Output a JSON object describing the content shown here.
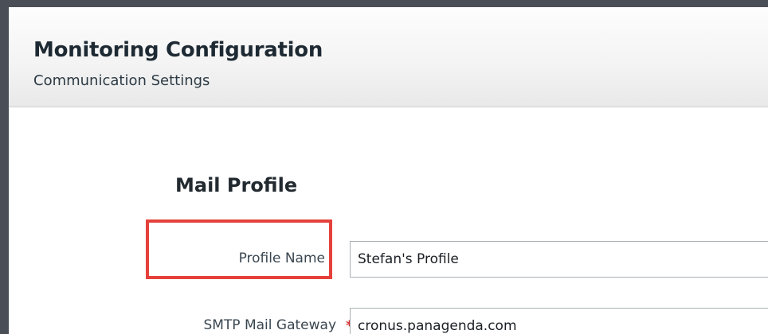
{
  "header": {
    "title": "Monitoring Configuration",
    "subtitle": "Communication Settings"
  },
  "section": {
    "title": "Mail Profile"
  },
  "form": {
    "profile_name": {
      "label": "Profile Name",
      "value": "Stefan's Profile"
    },
    "smtp_gateway": {
      "label": "SMTP Mail Gateway",
      "required_marker": "*",
      "value": "cronus.panagenda.com"
    }
  },
  "colors": {
    "highlight": "#e5413a",
    "required": "#d6312e",
    "backdrop": "#4a4f57"
  }
}
